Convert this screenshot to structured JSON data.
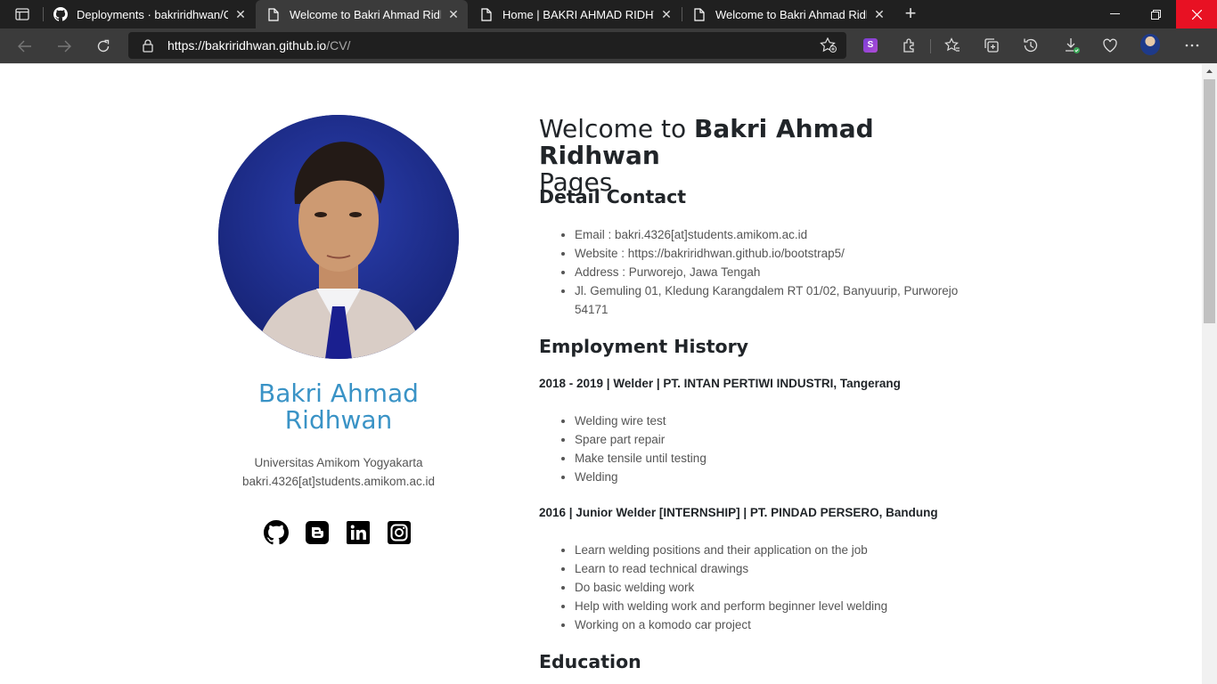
{
  "browser": {
    "tabs": [
      {
        "title": "Deployments · bakriridhwan/CV",
        "icon": "github-icon"
      },
      {
        "title": "Welcome to Bakri Ahmad Ridhwan Pages",
        "icon": "page-icon",
        "active": true
      },
      {
        "title": "Home | BAKRI AHMAD RIDHWAN",
        "icon": "page-icon"
      },
      {
        "title": "Welcome to Bakri Ahmad Ridhwan Pages",
        "icon": "page-icon"
      }
    ],
    "url_host": "https://bakriridhwan.github.io",
    "url_path": "/CV/",
    "extension_label": "S"
  },
  "profile": {
    "name": "Bakri Ahmad Ridhwan",
    "university": "Universitas Amikom Yogyakarta",
    "email": "bakri.4326[at]students.amikom.ac.id",
    "socials": [
      "github-icon",
      "blogger-icon",
      "linkedin-icon",
      "instagram-icon"
    ]
  },
  "main": {
    "heading_prefix": "Welcome to ",
    "heading_name": "Bakri Ahmad Ridhwan",
    "heading_suffix": "Pages",
    "contact": {
      "heading": "Detail Contact",
      "items": [
        "Email : bakri.4326[at]students.amikom.ac.id",
        "Website : https://bakriridhwan.github.io/bootstrap5/",
        "Address : Purworejo, Jawa Tengah",
        "Jl. Gemuling 01, Kledung Karangdalem RT 01/02, Banyuurip, Purworejo 54171"
      ]
    },
    "employment": {
      "heading": "Employment History",
      "jobs": [
        {
          "title": "2018 - 2019 | Welder | PT. INTAN PERTIWI INDUSTRI, Tangerang",
          "tasks": [
            "Welding wire test",
            "Spare part repair",
            "Make tensile until testing",
            "Welding"
          ]
        },
        {
          "title": "2016 | Junior Welder [INTERNSHIP] | PT. PINDAD PERSERO, Bandung",
          "tasks": [
            "Learn welding positions and their application on the job",
            "Learn to read technical drawings",
            "Do basic welding work",
            "Help with welding work and perform beginner level welding",
            "Working on a komodo car project"
          ]
        }
      ]
    },
    "education": {
      "heading": "Education"
    }
  }
}
